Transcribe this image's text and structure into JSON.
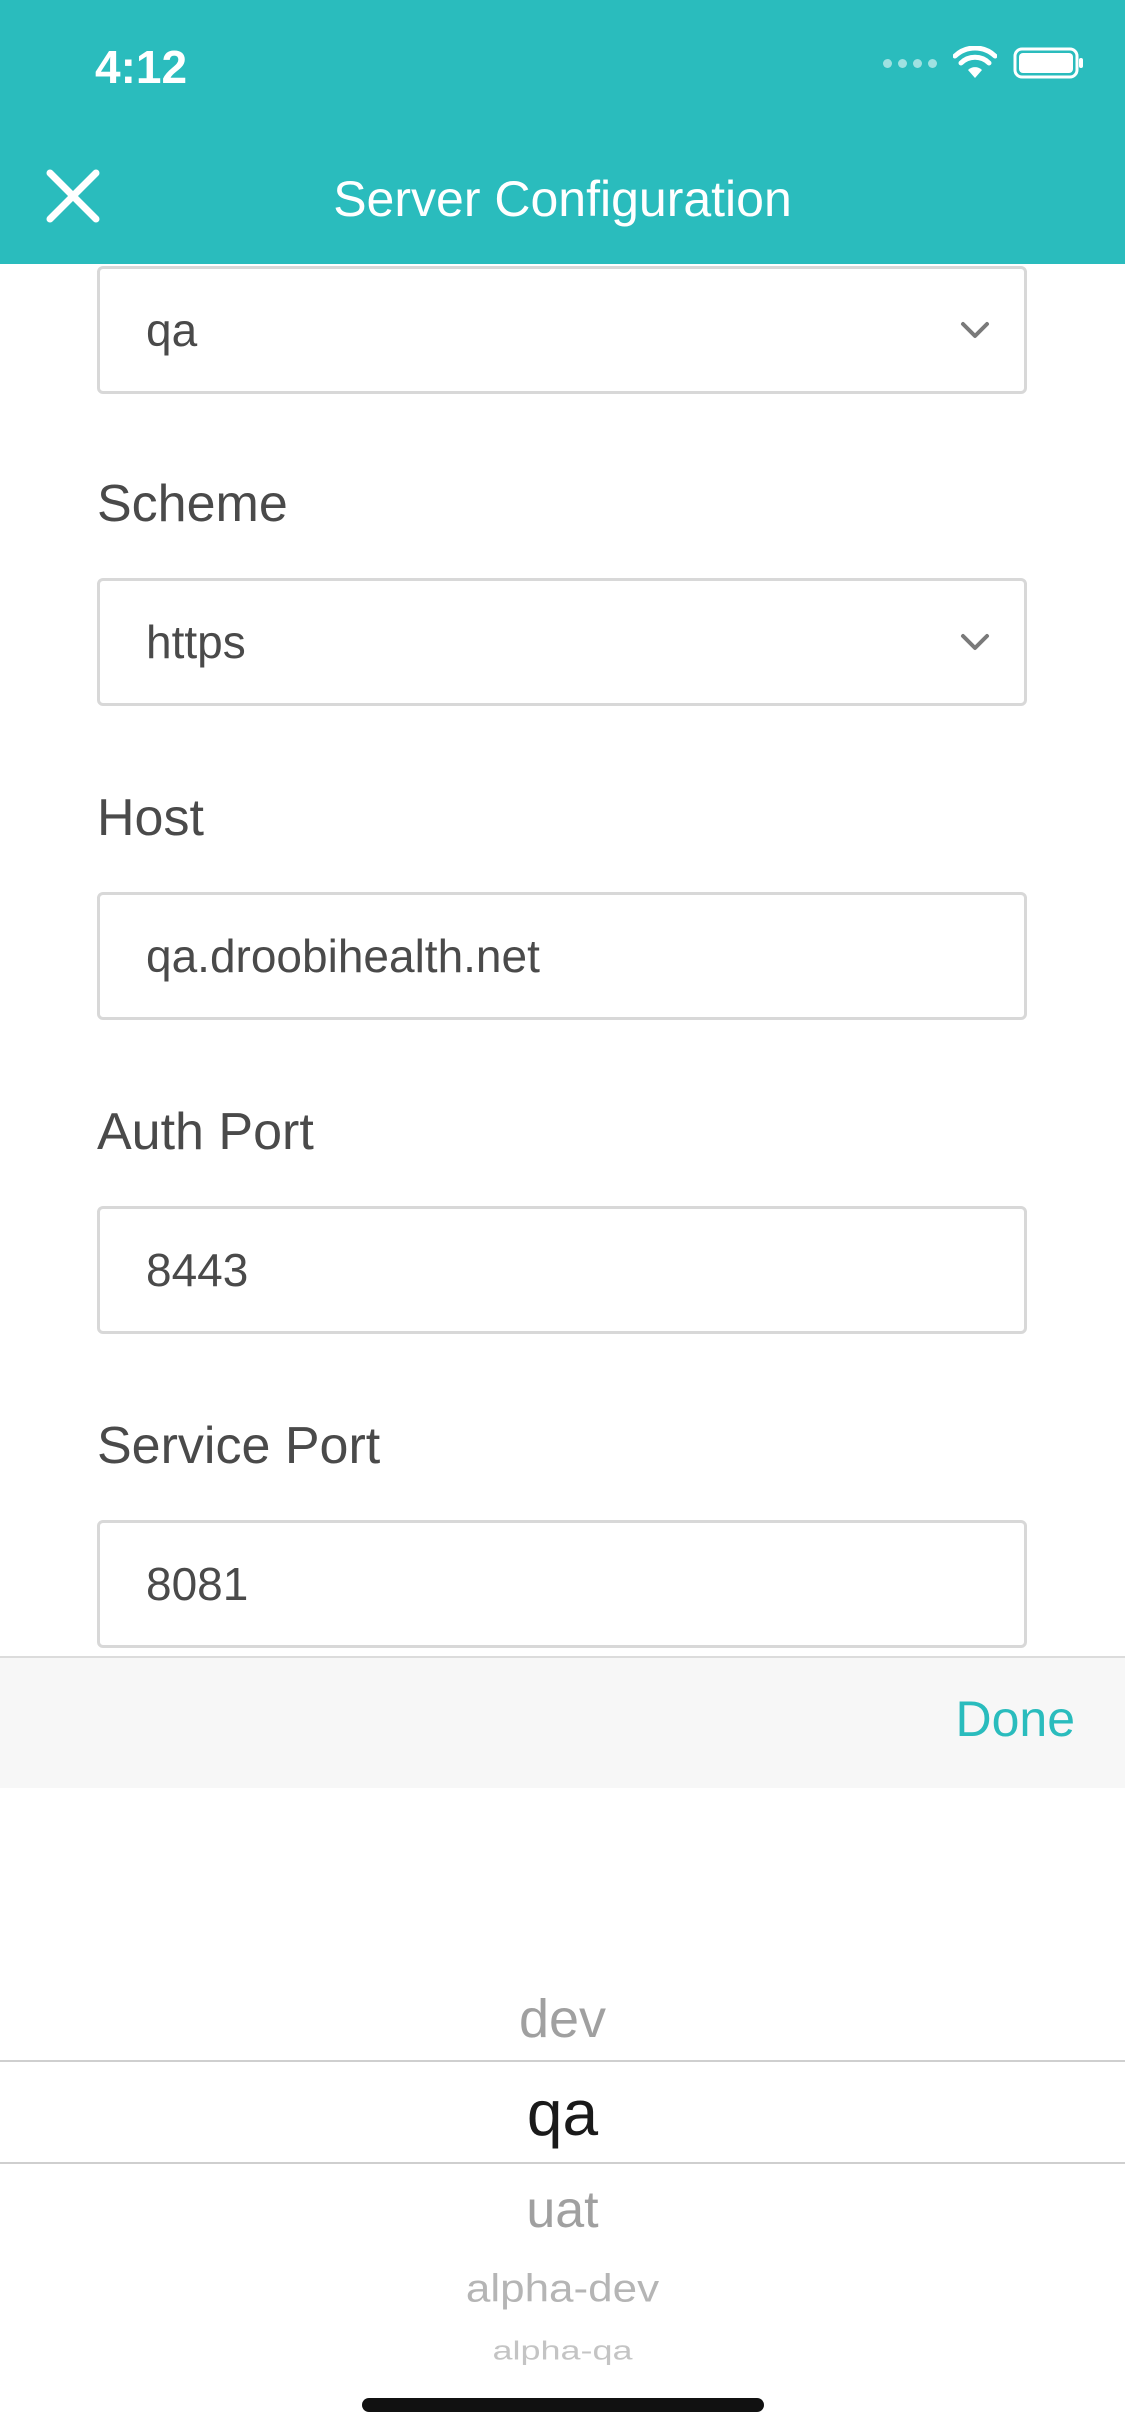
{
  "status_bar": {
    "time": "4:12"
  },
  "nav": {
    "title": "Server Configuration",
    "close_icon": "close-icon"
  },
  "form": {
    "environment": {
      "value": "qa"
    },
    "scheme": {
      "label": "Scheme",
      "value": "https"
    },
    "host": {
      "label": "Host",
      "value": "qa.droobihealth.net"
    },
    "auth_port": {
      "label": "Auth Port",
      "value": "8443"
    },
    "service_port": {
      "label": "Service Port",
      "value": "8081"
    }
  },
  "toolbar": {
    "done_label": "Done"
  },
  "picker": {
    "options": [
      "dev",
      "qa",
      "uat",
      "alpha-dev",
      "alpha-qa"
    ],
    "selected": "qa"
  },
  "colors": {
    "accent": "#2abcbd",
    "text": "#4a4a4a",
    "border": "#d8d8d8"
  }
}
